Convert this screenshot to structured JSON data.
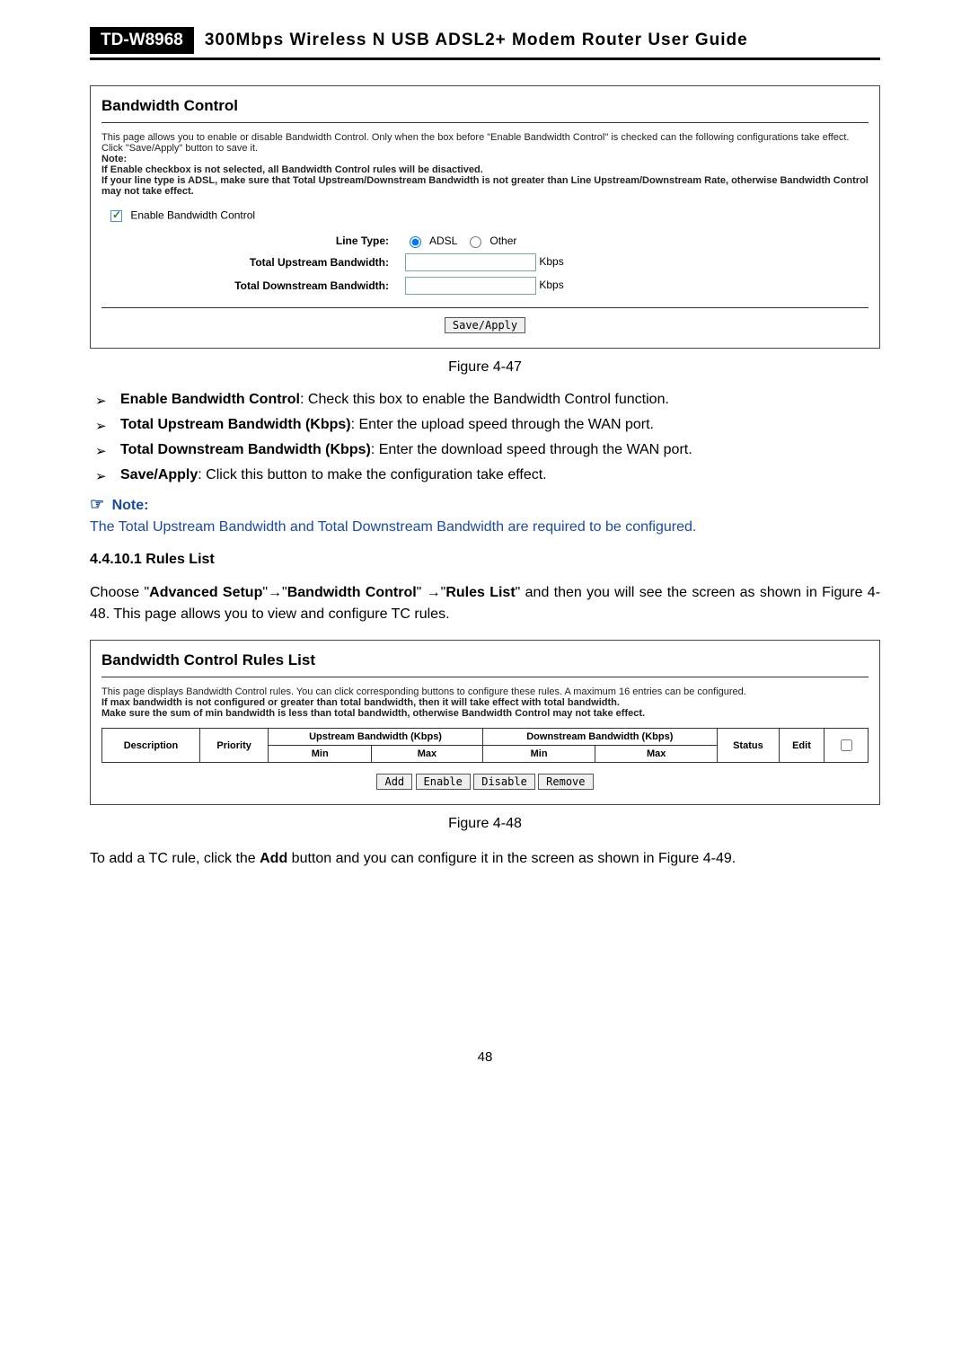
{
  "header": {
    "model": "TD-W8968",
    "desc": "300Mbps Wireless N USB ADSL2+ Modem Router User Guide"
  },
  "panel1": {
    "title": "Bandwidth Control",
    "intro": "This page allows you to enable or disable Bandwidth Control. Only when the box before \"Enable Bandwidth Control\" is checked can the following configurations take effect.",
    "intro2": "Click \"Save/Apply\" button to save it.",
    "noteLabel": "Note:",
    "note1": "If Enable checkbox is not selected, all Bandwidth Control rules will be disactived.",
    "note2": "If your line type is ADSL, make sure that Total Upstream/Downstream Bandwidth is not greater than Line Upstream/Downstream Rate, otherwise Bandwidth Control may not take effect.",
    "enableLabel": "Enable Bandwidth Control",
    "lineTypeLabel": "Line Type:",
    "adsl": "ADSL",
    "other": "Other",
    "upLabel": "Total Upstream Bandwidth:",
    "downLabel": "Total Downstream Bandwidth:",
    "kbps": "Kbps",
    "saveBtn": "Save/Apply"
  },
  "fig47": "Figure 4-47",
  "bullets": [
    {
      "b": "Enable Bandwidth Control",
      "t": ": Check this box to enable the Bandwidth Control function."
    },
    {
      "b": "Total Upstream Bandwidth (Kbps)",
      "t": ": Enter the upload speed through the WAN port."
    },
    {
      "b": "Total Downstream Bandwidth (Kbps)",
      "t": ": Enter the download speed through the WAN port."
    },
    {
      "b": "Save/Apply",
      "t": ": Click this button to make the configuration take effect."
    }
  ],
  "noteHead": "Note:",
  "noteBody": "The Total Upstream Bandwidth and Total Downstream Bandwidth are required to be configured.",
  "secSub": "4.4.10.1  Rules List",
  "para1a": "Choose \"",
  "para1b": "Advanced Setup",
  "para1c": "\"→\"",
  "para1d": "Bandwidth Control",
  "para1e": "\" →\"",
  "para1f": "Rules List",
  "para1g": "\" and then you will see the screen as shown in Figure 4-48. This page allows you to view and configure TC rules.",
  "panel2": {
    "title": "Bandwidth Control Rules List",
    "line1": "This page displays Bandwidth Control rules. You can click corresponding buttons to configure these rules. A maximum 16 entries can be configured.",
    "line2": "If max bandwidth is not configured or greater than total bandwidth, then it will take effect with total bandwidth.",
    "line3": "Make sure the sum of min bandwidth is less than total bandwidth, otherwise Bandwidth Control may not take effect.",
    "th": {
      "desc": "Description",
      "prio": "Priority",
      "up": "Upstream Bandwidth (Kbps)",
      "down": "Downstream Bandwidth (Kbps)",
      "status": "Status",
      "edit": "Edit",
      "min": "Min",
      "max": "Max"
    },
    "btns": {
      "add": "Add",
      "enable": "Enable",
      "disable": "Disable",
      "remove": "Remove"
    }
  },
  "fig48": "Figure 4-48",
  "para2a": "To add a TC rule, click the ",
  "para2b": "Add",
  "para2c": " button and you can configure it in the screen as shown in Figure 4-49.",
  "pagenum": "48"
}
